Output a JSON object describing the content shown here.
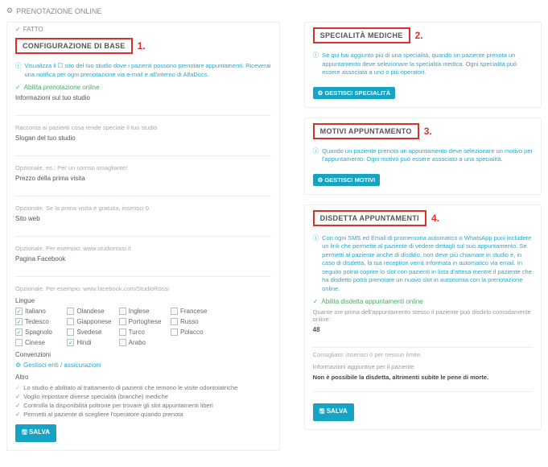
{
  "page_title": "PRENOTAZIONE ONLINE",
  "done_label": "FATTO",
  "markers": {
    "1": "1.",
    "2": "2.",
    "3": "3.",
    "4": "4."
  },
  "config": {
    "title": "CONFIGURAZIONE DI BASE",
    "info": "Visualizza il ☐ sito del tuo studio dove i pazienti possono prenotare appuntamenti. Riceverai una notifica per ogni prenotazione via e-mail e all'interno di AlfaDocs.",
    "enable": "Abilita prenotazione online",
    "studio_info": "Informazioni sul tuo studio",
    "hint_special": "Racconta ai pazienti cosa rende speciale il tuo studio",
    "slogan": "Slogan del tuo studio",
    "hint_opt1": "Opzionale, es.: Per un sorriso smagliante!",
    "first_visit": "Prezzo della prima visita",
    "hint_opt2": "Opzionale. Se la prima visita è gratuita, inserisci 0.",
    "website": "Sito web",
    "hint_opt3": "Opzionale. Per esempio: www.studiorossi.it",
    "facebook": "Pagina Facebook",
    "hint_opt4": "Opzionale. Per esempio: www.facebook.com/StudioRossi",
    "lang_label": "Lingue",
    "langs": {
      "it": "Italiano",
      "nl": "Olandese",
      "en": "Inglese",
      "fr": "Francese",
      "de": "Tedesco",
      "ja": "Giapponese",
      "pt": "Portoghese",
      "ru": "Russo",
      "es": "Spagnolo",
      "sv": "Svedese",
      "tr": "Turco",
      "pl": "Polacco",
      "zh": "Cinese",
      "hi": "Hindi",
      "ar": "Arabo"
    },
    "conv_label": "Convenzioni",
    "conv_link": "Gestisci enti / assicurazioni",
    "other_label": "Altro",
    "other_items": [
      "Lo studio è abilitato al trattamento di pazienti che temono le visite odontoiatriche",
      "Voglio impostare diverse specialità (branche) mediche",
      "Controlla la disponibilità poltrone per trovare gli slot appuntamenti liberi",
      "Permetti al paziente di scegliere l'operatore quando prenota"
    ],
    "save": "SALVA"
  },
  "spec": {
    "title": "SPECIALITÀ MEDICHE",
    "info": "Se qui hai aggiunto più di una specialità, quando un paziente prenota un appuntamento deve selezionare la specialità medica. Ogni specialità può essere associata a uno o più operatori.",
    "btn": "GESTISCI SPECIALITÀ"
  },
  "motivi": {
    "title": "MOTIVI APPUNTAMENTO",
    "info": "Quando un paziente prenota un appuntamento deve selezionare un motivo per l'appuntamento. Ogni motivo può essere associato a una specialità.",
    "btn": "GESTISCI MOTIVI"
  },
  "disdetta": {
    "title": "DISDETTA APPUNTAMENTI",
    "info": "Con ogni SMS ed Email di promemoria automatico o WhatsApp puoi includere un link che permette al paziente di vedere dettagli sul suo appuntamento. Se permetti al paziente anche di disdirlo, non deve più chiamare in studio e, in caso di disdetta, la tua reception verrà informata in automatico via email. In seguito potrai coprire lo slot con pazienti in lista d'attesa mentre il paziente che ha disdetto potrà prenotare un nuovo slot in autonomia con la prenotazione online.",
    "enable": "Abilita disdetta appuntamenti online",
    "hours_label": "Quante ore prima dell'appuntamento stesso il paziente può disdirlo comodamente online:",
    "hours_value": "48",
    "hours_hint": "Consigliato: inserisci 0 per nessun limite.",
    "extra_label": "Informazioni aggiuntive per il paziente",
    "extra_note": "Non è possibile la disdetta, altrimenti subite le pene di morte.",
    "save": "SALVA"
  }
}
